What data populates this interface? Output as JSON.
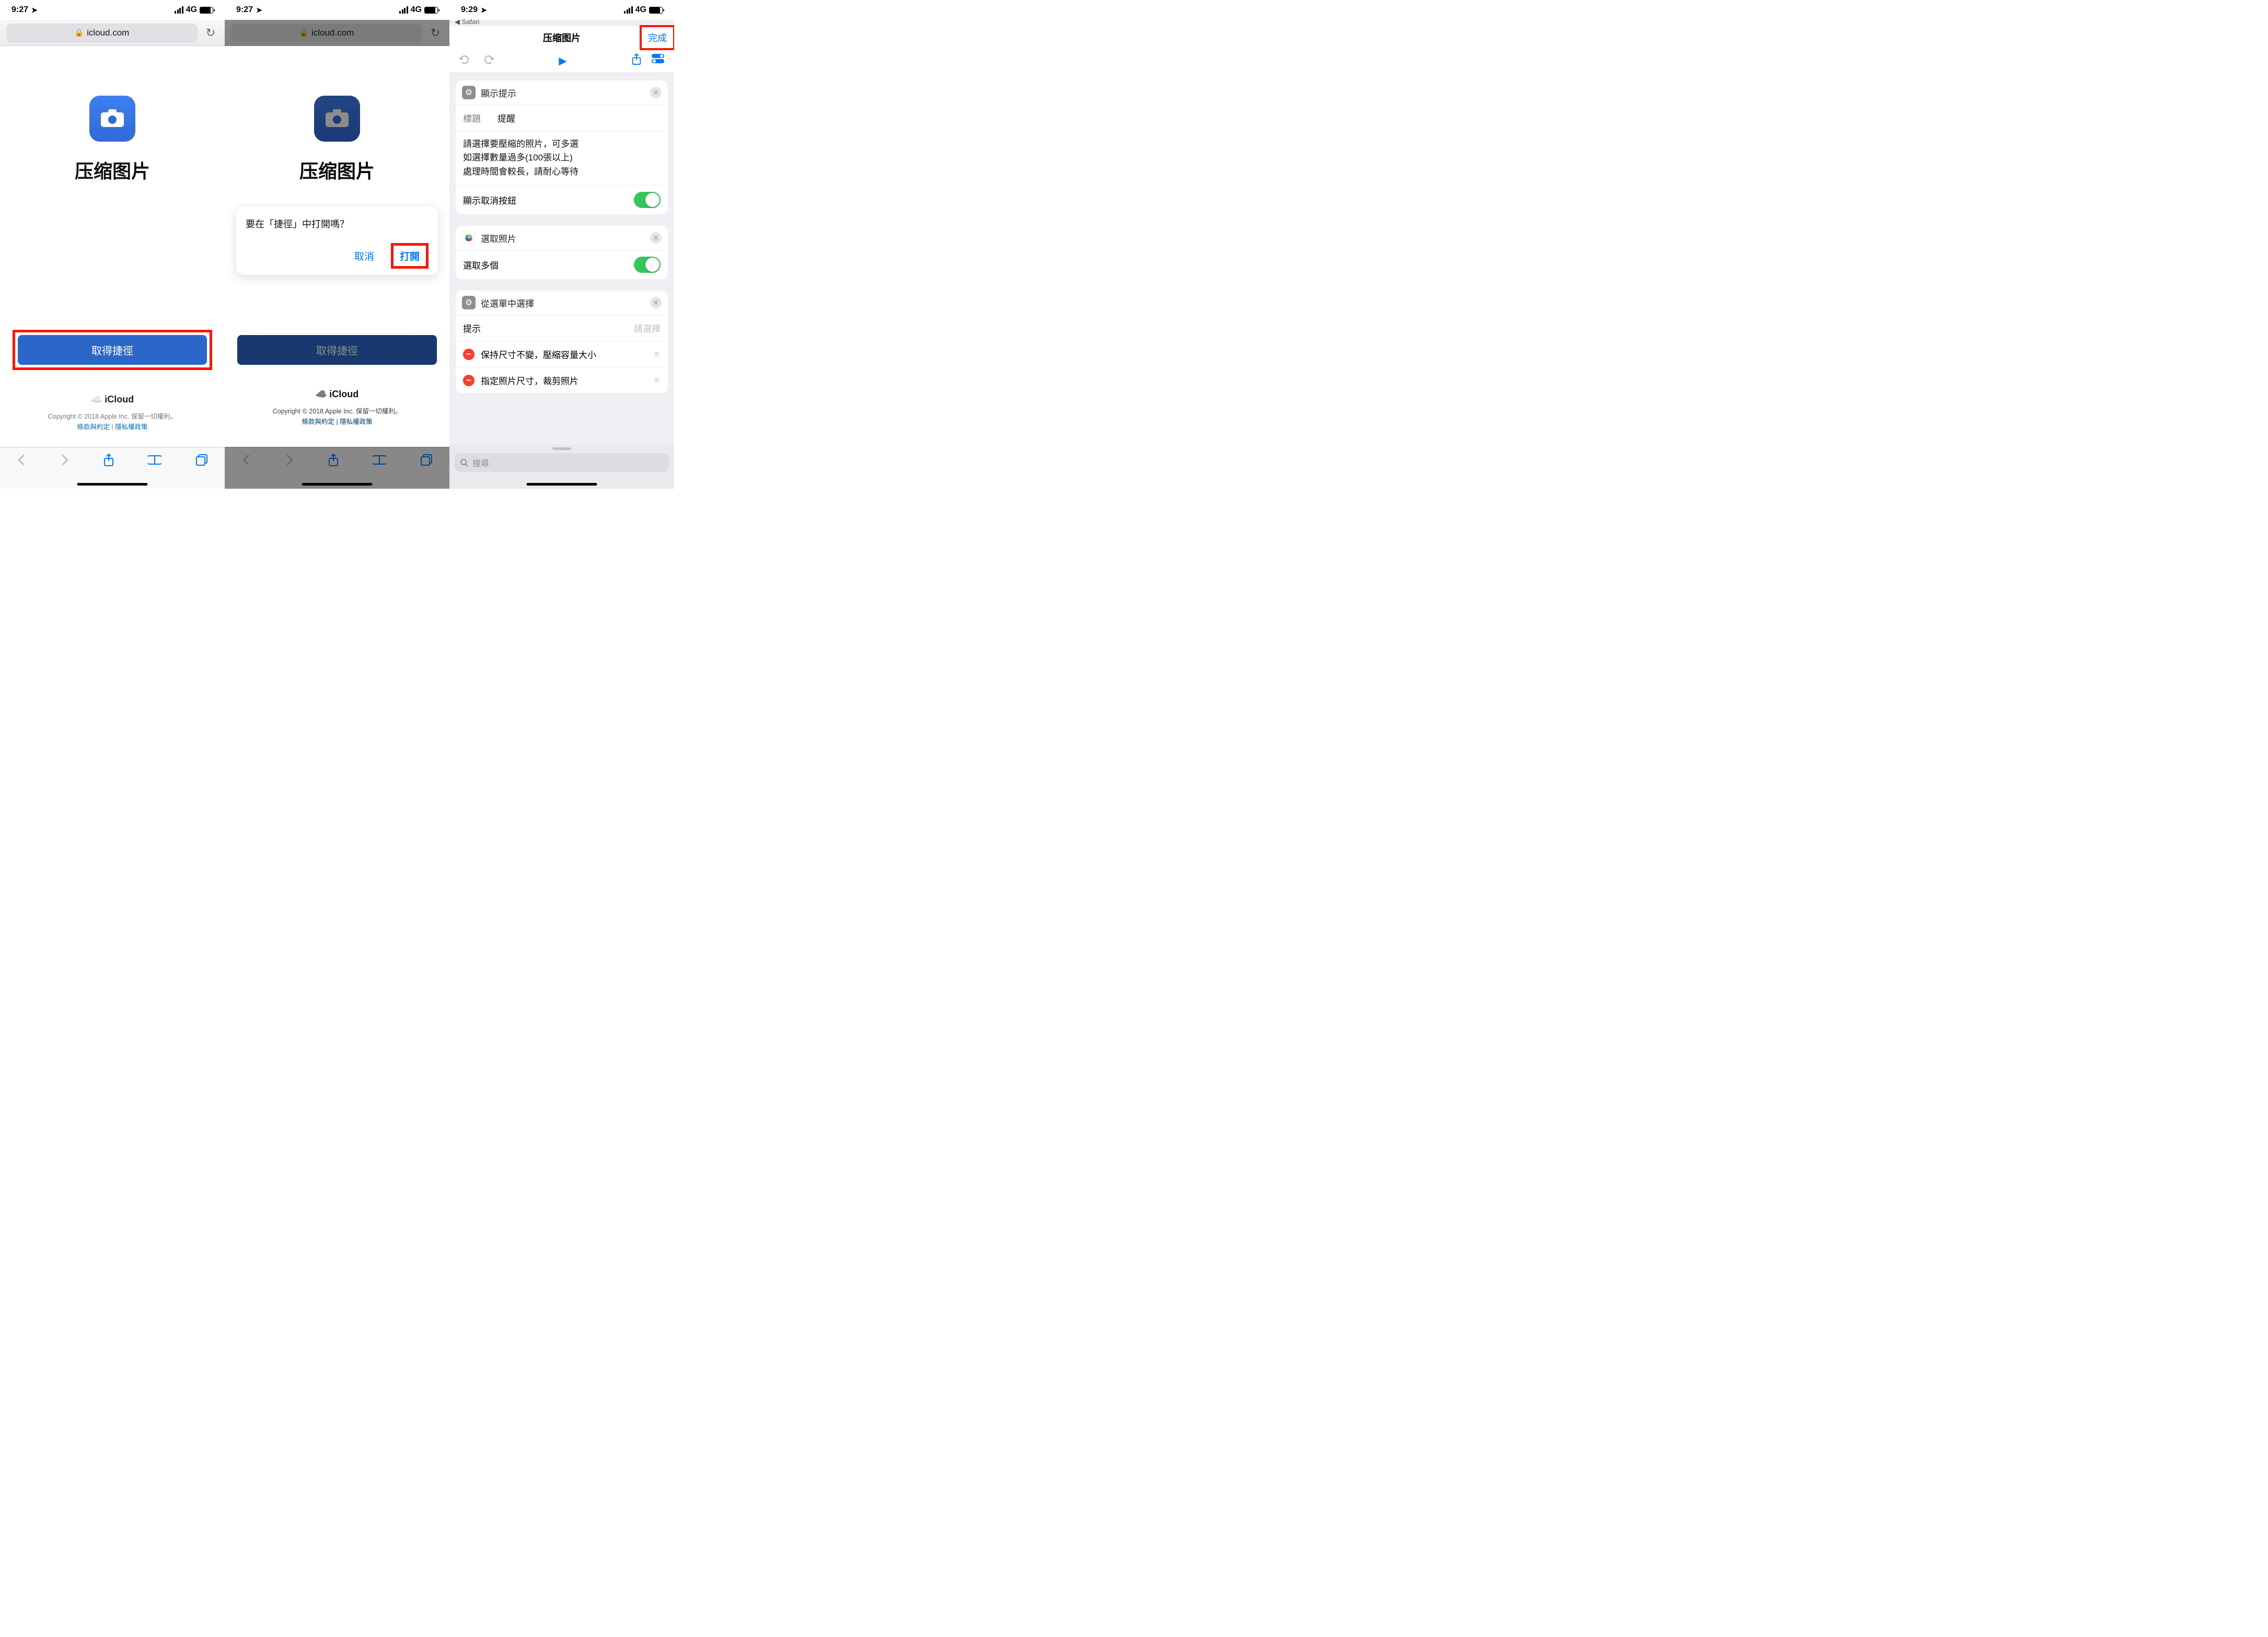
{
  "phone1": {
    "status": {
      "time": "9:27",
      "network": "4G"
    },
    "url": "icloud.com",
    "app_title": "压缩图片",
    "get_button": "取得捷徑",
    "footer": {
      "brand": "iCloud",
      "copyright": "Copyright © 2018 Apple Inc. 保留一切權利。",
      "terms": "條款與約定",
      "sep": " | ",
      "privacy": "隱私權政策"
    }
  },
  "phone2": {
    "status": {
      "time": "9:27",
      "network": "4G"
    },
    "url": "icloud.com",
    "app_title": "压缩图片",
    "get_button": "取得捷徑",
    "dialog": {
      "message": "要在「捷徑」中打開嗎？",
      "cancel": "取消",
      "open": "打開"
    },
    "footer": {
      "brand": "iCloud",
      "copyright": "Copyright © 2018 Apple Inc. 保留一切權利。",
      "terms": "條款與約定",
      "sep": " | ",
      "privacy": "隱私權政策"
    }
  },
  "phone3": {
    "status": {
      "time": "9:29",
      "network": "4G"
    },
    "back_app": "Safari",
    "nav_title": "压缩图片",
    "done": "完成",
    "action1": {
      "head": "顯示提示",
      "title_label": "標題",
      "title_value": "提醒",
      "body": "請選擇要壓縮的照片，可多選\n如選擇數量過多(100張以上)\n處理時間會較長，請耐心等待",
      "cancel_toggle_label": "顯示取消按鈕"
    },
    "action2": {
      "head": "選取照片",
      "multi_label": "選取多個"
    },
    "action3": {
      "head": "從選單中選擇",
      "prompt_label": "提示",
      "prompt_placeholder": "請選擇",
      "item1": "保持尺寸不變，壓縮容量大小",
      "item2": "指定照片尺寸，裁剪照片"
    },
    "search_placeholder": "搜尋"
  }
}
